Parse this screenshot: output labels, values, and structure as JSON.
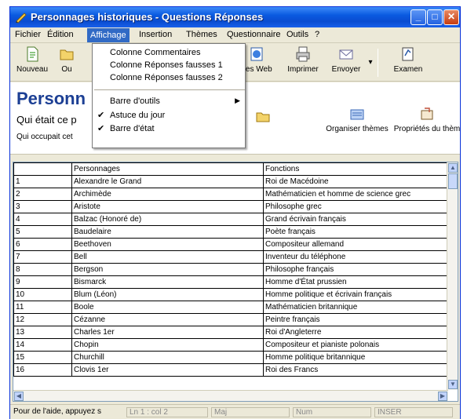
{
  "window": {
    "title": "Personnages historiques - Questions Réponses"
  },
  "menubar": {
    "items": [
      "Fichier",
      "Édition",
      "Affichage",
      "Insertion",
      "Thèmes",
      "Questionnaire",
      "Outils",
      "?"
    ],
    "active": "Affichage"
  },
  "toolbar": {
    "nouveau": "Nouveau",
    "ouvrir": "Ou",
    "pages_web": "ges Web",
    "imprimer": "Imprimer",
    "envoyer": "Envoyer",
    "examen": "Examen"
  },
  "header": {
    "title": "Personn",
    "question1": "Qui était ce p",
    "question2": "Qui occupait cet",
    "organiser": "Organiser thèmes",
    "proprietes": "Propriétés du thèm"
  },
  "dropdown": {
    "items": [
      {
        "label": "Colonne Commentaires",
        "checked": false,
        "submenu": false
      },
      {
        "label": "Colonne Réponses fausses 1",
        "checked": false,
        "submenu": false
      },
      {
        "label": "Colonne Réponses fausses 2",
        "checked": false,
        "submenu": false
      },
      {
        "label": "Barre d'outils",
        "checked": false,
        "submenu": true
      },
      {
        "label": "Astuce du jour",
        "checked": true,
        "submenu": false
      },
      {
        "label": "Barre d'état",
        "checked": true,
        "submenu": false
      }
    ]
  },
  "grid": {
    "headers": [
      "",
      "Personnages",
      "Fonctions"
    ],
    "rows": [
      [
        "1",
        "Alexandre le Grand",
        "Roi de Macédoine"
      ],
      [
        "2",
        "Archimède",
        "Mathématicien et homme de science grec"
      ],
      [
        "3",
        "Aristote",
        "Philosophe grec"
      ],
      [
        "4",
        "Balzac (Honoré de)",
        "Grand écrivain français"
      ],
      [
        "5",
        "Baudelaire",
        "Poète français"
      ],
      [
        "6",
        "Beethoven",
        "Compositeur allemand"
      ],
      [
        "7",
        "Bell",
        "Inventeur du téléphone"
      ],
      [
        "8",
        "Bergson",
        "Philosophe français"
      ],
      [
        "9",
        "Bismarck",
        "Homme d'État prussien"
      ],
      [
        "10",
        "Blum (Léon)",
        "Homme politique et écrivain français"
      ],
      [
        "11",
        "Boole",
        "Mathématicien britannique"
      ],
      [
        "12",
        "Cézanne",
        "Peintre français"
      ],
      [
        "13",
        "Charles 1er",
        "Roi d'Angleterre"
      ],
      [
        "14",
        "Chopin",
        "Compositeur et pianiste polonais"
      ],
      [
        "15",
        "Churchill",
        "Homme politique britannique"
      ],
      [
        "16",
        "Clovis 1er",
        "Roi des Francs"
      ]
    ]
  },
  "statusbar": {
    "help": "Pour de l'aide, appuyez s",
    "position": "Ln 1 : col 2",
    "maj": "Maj",
    "num": "Num",
    "insert": "INSER"
  },
  "colors": {
    "title_bar": "#0a4cd0",
    "menu_highlight": "#316ac5",
    "header_title": "#1c3f94"
  }
}
